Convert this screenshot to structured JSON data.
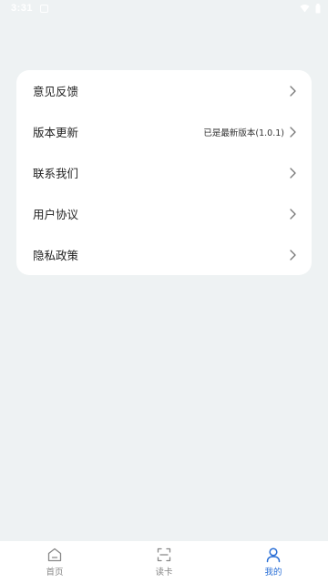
{
  "status_bar": {
    "time": "3:31"
  },
  "menu": {
    "items": [
      {
        "label": "意见反馈",
        "value": ""
      },
      {
        "label": "版本更新",
        "value": "已是最新版本(1.0.1)"
      },
      {
        "label": "联系我们",
        "value": ""
      },
      {
        "label": "用户协议",
        "value": ""
      },
      {
        "label": "隐私政策",
        "value": ""
      }
    ]
  },
  "tabbar": {
    "tabs": [
      {
        "label": "首页",
        "icon": "home-icon",
        "active": false
      },
      {
        "label": "读卡",
        "icon": "scan-icon",
        "active": false
      },
      {
        "label": "我的",
        "icon": "user-icon",
        "active": true
      }
    ]
  },
  "colors": {
    "background": "#eef2f3",
    "card": "#ffffff",
    "accent": "#2a6fd6",
    "inactive": "#888888"
  }
}
